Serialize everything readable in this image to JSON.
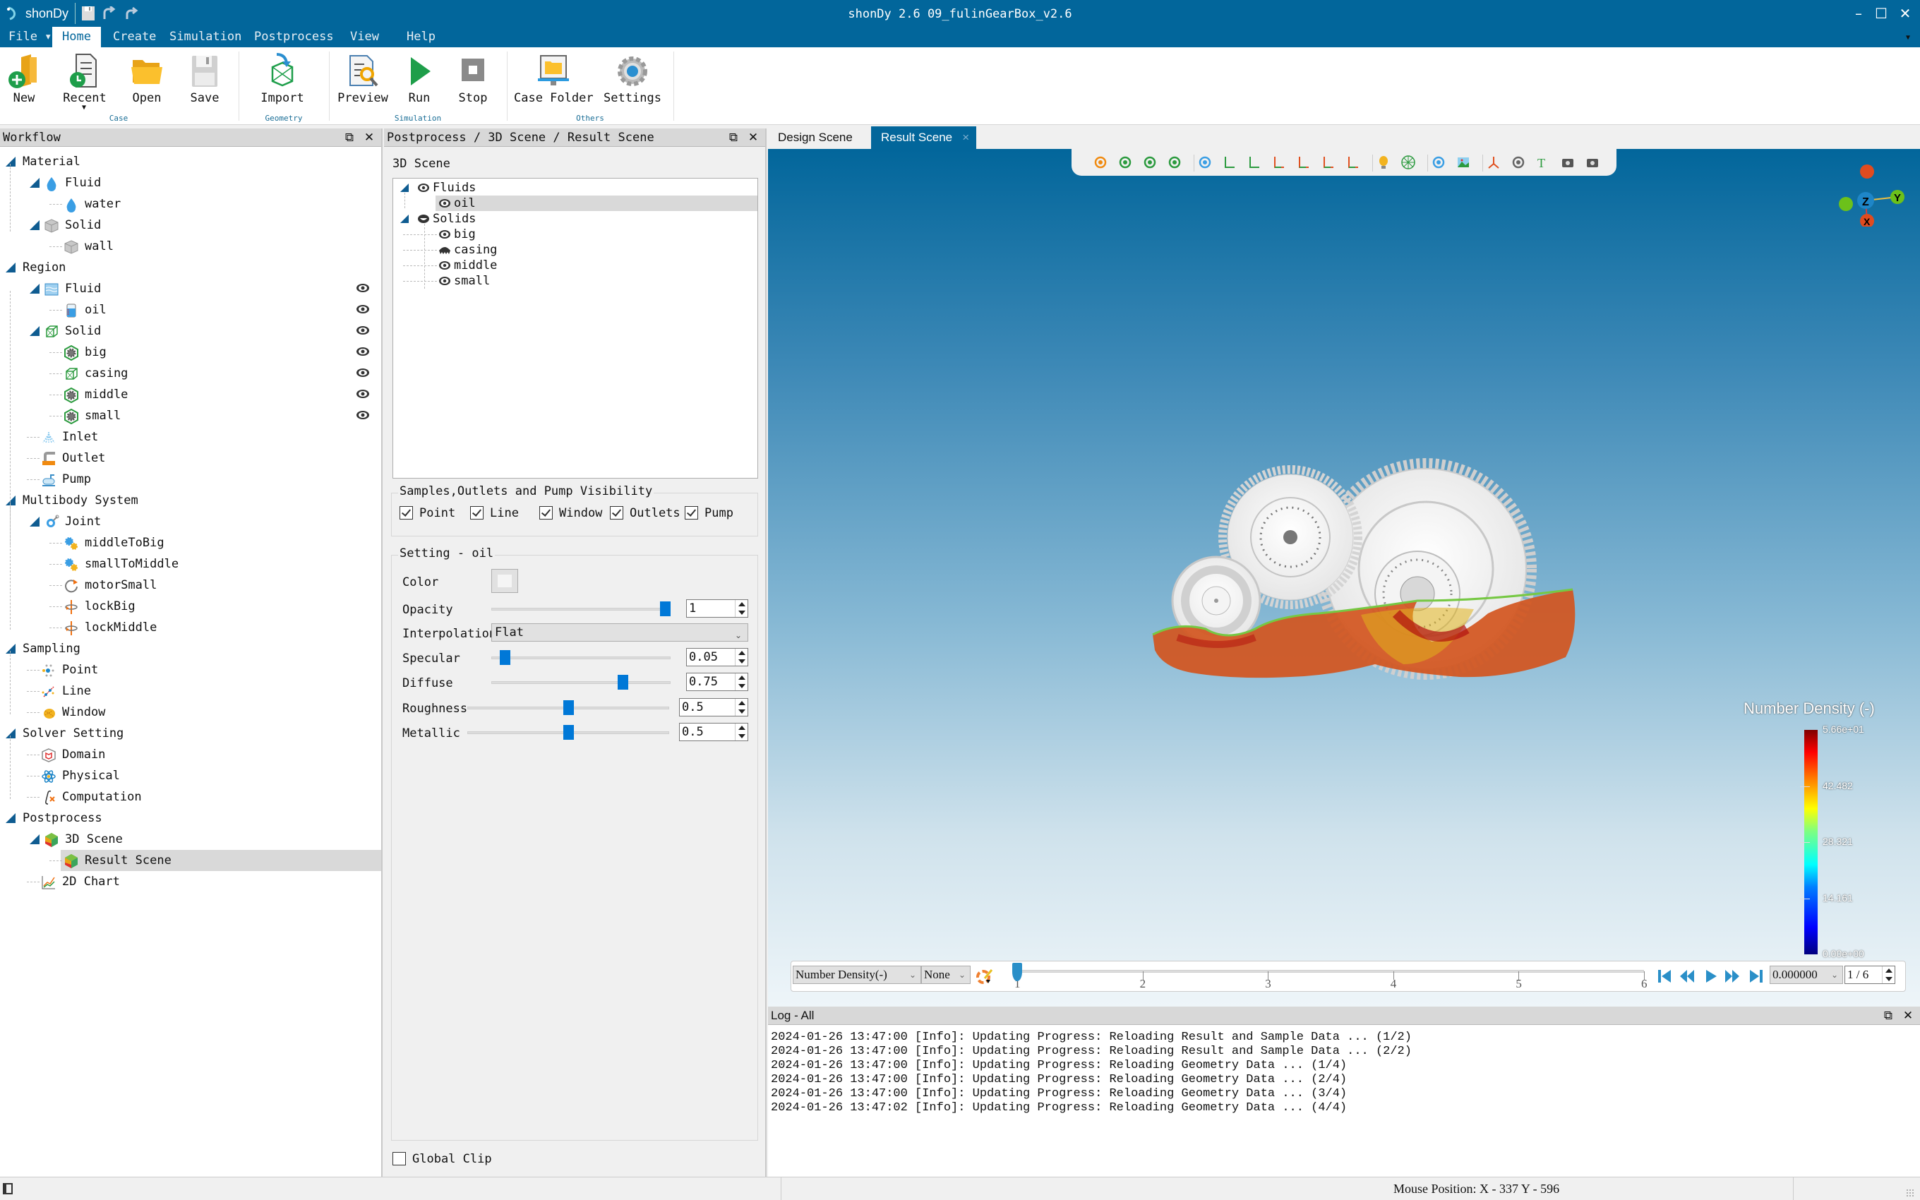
{
  "app": {
    "name": "shonDy",
    "window_title": "shonDy 2.6  09_fulinGearBox_v2.6"
  },
  "window_controls": {
    "minimize": "–",
    "maximize": "☐",
    "close": "✕"
  },
  "menu": [
    {
      "label": "File ▾"
    },
    {
      "label": "Home",
      "active": true
    },
    {
      "label": "Create"
    },
    {
      "label": "Simulation"
    },
    {
      "label": "Postprocess"
    },
    {
      "label": "View"
    },
    {
      "label": "Help"
    }
  ],
  "ribbon": {
    "buttons": {
      "new": "New",
      "recent": "Recent",
      "open": "Open",
      "save": "Save",
      "import": "Import",
      "preview": "Preview",
      "run": "Run",
      "stop": "Stop",
      "case_folder": "Case Folder",
      "settings": "Settings"
    },
    "groups": {
      "case": "Case",
      "geometry": "Geometry",
      "simulation": "Simulation",
      "others": "Others"
    }
  },
  "workflow": {
    "title": "Workflow",
    "items": [
      {
        "label": "Material",
        "icon": "folder"
      },
      {
        "label": "Fluid",
        "icon": "droplet"
      },
      {
        "label": "water",
        "icon": "droplet"
      },
      {
        "label": "Solid",
        "icon": "cube"
      },
      {
        "label": "wall",
        "icon": "cube"
      },
      {
        "label": "Region",
        "icon": "folder"
      },
      {
        "label": "Fluid",
        "icon": "water-wave"
      },
      {
        "label": "oil",
        "icon": "beaker"
      },
      {
        "label": "Solid",
        "icon": "wire-cube"
      },
      {
        "label": "big",
        "icon": "gear-hex"
      },
      {
        "label": "casing",
        "icon": "wire-cube"
      },
      {
        "label": "middle",
        "icon": "gear-hex"
      },
      {
        "label": "small",
        "icon": "gear-hex"
      },
      {
        "label": "Inlet",
        "icon": "sprinkler"
      },
      {
        "label": "Outlet",
        "icon": "outlet-pipe"
      },
      {
        "label": "Pump",
        "icon": "pump"
      },
      {
        "label": "Multibody System",
        "icon": "folder"
      },
      {
        "label": "Joint",
        "icon": "joint"
      },
      {
        "label": "middleToBig",
        "icon": "gears"
      },
      {
        "label": "smallToMiddle",
        "icon": "gears"
      },
      {
        "label": "motorSmall",
        "icon": "rotate"
      },
      {
        "label": "lockBig",
        "icon": "lock-axis"
      },
      {
        "label": "lockMiddle",
        "icon": "lock-axis"
      },
      {
        "label": "Sampling",
        "icon": "folder"
      },
      {
        "label": "Point",
        "icon": "points"
      },
      {
        "label": "Line",
        "icon": "line"
      },
      {
        "label": "Window",
        "icon": "window-sample"
      },
      {
        "label": "Solver Setting",
        "icon": "folder"
      },
      {
        "label": "Domain",
        "icon": "domain-box"
      },
      {
        "label": "Physical",
        "icon": "atom"
      },
      {
        "label": "Computation",
        "icon": "integral"
      },
      {
        "label": "Postprocess",
        "icon": "folder"
      },
      {
        "label": "3D Scene",
        "icon": "scene-cube"
      },
      {
        "label": "Result Scene",
        "icon": "scene-cube",
        "selected": true
      },
      {
        "label": "2D Chart",
        "icon": "chart"
      }
    ]
  },
  "midpanel": {
    "breadcrumb": "Postprocess / 3D Scene / Result Scene",
    "scene_label": "3D Scene",
    "scene_tree": [
      {
        "label": "Fluids",
        "visible": true
      },
      {
        "label": "oil",
        "visible": true,
        "selected": true
      },
      {
        "label": "Solids",
        "visible": "partial"
      },
      {
        "label": "big",
        "visible": true
      },
      {
        "label": "casing",
        "visible": "mixed"
      },
      {
        "label": "middle",
        "visible": true
      },
      {
        "label": "small",
        "visible": true
      }
    ],
    "visibility_group": {
      "title": "Samples,Outlets and Pump Visibility",
      "checkboxes": [
        {
          "label": "Point",
          "checked": true
        },
        {
          "label": "Line",
          "checked": true
        },
        {
          "label": "Window",
          "checked": true
        },
        {
          "label": "Outlets",
          "checked": true
        },
        {
          "label": "Pump",
          "checked": true
        }
      ]
    },
    "setting": {
      "title": "Setting - oil",
      "color_label": "Color",
      "color_value": "#f5f5f5",
      "opacity_label": "Opacity",
      "opacity": "1",
      "interpolation_label": "Interpolation",
      "interpolation": "Flat",
      "specular_label": "Specular",
      "specular": "0.05",
      "diffuse_label": "Diffuse",
      "diffuse": "0.75",
      "roughness_label": "Roughness",
      "roughness": "0.5",
      "metallic_label": "Metallic",
      "metallic": "0.5"
    },
    "global_clip": {
      "label": "Global Clip",
      "checked": false
    }
  },
  "scene_tabs": [
    {
      "label": "Design Scene"
    },
    {
      "label": "Result Scene",
      "active": true,
      "close": "×"
    }
  ],
  "viewport": {
    "axes": {
      "x": "X",
      "y": "Y",
      "z": "Z"
    },
    "colorbar": {
      "title": "Number Density (-)",
      "max": "5.66e+01",
      "ticks": [
        "42.482",
        "28.321",
        "14.161"
      ],
      "min": "0.00e+00"
    },
    "timebar": {
      "field": "Number Density(-)",
      "component": "None",
      "frames": [
        "1",
        "2",
        "3",
        "4",
        "5",
        "6"
      ],
      "current_frame_fraction": 0,
      "time": "0.000000",
      "frame_counter": "1 / 6"
    }
  },
  "log": {
    "title": "Log - All",
    "lines": [
      "2024-01-26 13:47:00 [Info]: Updating Progress: Reloading Result and Sample Data ... (1/2)",
      "2024-01-26 13:47:00 [Info]: Updating Progress: Reloading Result and Sample Data ... (2/2)",
      "2024-01-26 13:47:00 [Info]: Updating Progress: Reloading Geometry Data ... (1/4)",
      "2024-01-26 13:47:00 [Info]: Updating Progress: Reloading Geometry Data ... (2/4)",
      "2024-01-26 13:47:00 [Info]: Updating Progress: Reloading Geometry Data ... (3/4)",
      "2024-01-26 13:47:02 [Info]: Updating Progress: Reloading Geometry Data ... (4/4)"
    ]
  },
  "status": {
    "mouse_position": "Mouse Position: X - 337  Y - 596"
  },
  "colors": {
    "brand": "#02669b",
    "accent": "#0078d7",
    "selection": "#d9d9d9"
  }
}
